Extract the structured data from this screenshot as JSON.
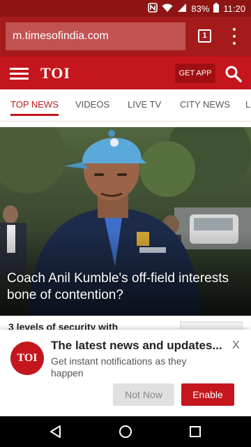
{
  "status_bar": {
    "nfc_icon": "nfc-icon",
    "wifi_icon": "wifi-icon",
    "signal_icon": "signal-icon",
    "battery_percent": "83%",
    "battery_icon": "battery-icon",
    "time": "11:20"
  },
  "browser": {
    "url": "m.timesofindia.com",
    "tab_count": "1",
    "menu_icon": "more-vert-icon"
  },
  "app_bar": {
    "menu_icon": "hamburger-icon",
    "logo": "TOI",
    "get_app_label": "GET APP",
    "search_icon": "search-icon",
    "brand_color": "#c4161c"
  },
  "tabs": [
    {
      "label": "TOP NEWS",
      "active": true
    },
    {
      "label": "VIDEOS",
      "active": false
    },
    {
      "label": "LIVE TV",
      "active": false
    },
    {
      "label": "CITY NEWS",
      "active": false
    },
    {
      "label": "L",
      "active": false
    }
  ],
  "hero": {
    "headline": "Coach Anil Kumble's off-field interests bone of contention?"
  },
  "second_story": {
    "headline": "3 levels of security with"
  },
  "notification_prompt": {
    "logo": "TOI",
    "title": "The latest news and updates...",
    "body": "Get instant notifications as they happen",
    "close_label": "X",
    "not_now_label": "Not Now",
    "enable_label": "Enable"
  },
  "nav_bar": {
    "back_icon": "back-triangle-icon",
    "home_icon": "home-circle-icon",
    "recents_icon": "recents-square-icon"
  }
}
